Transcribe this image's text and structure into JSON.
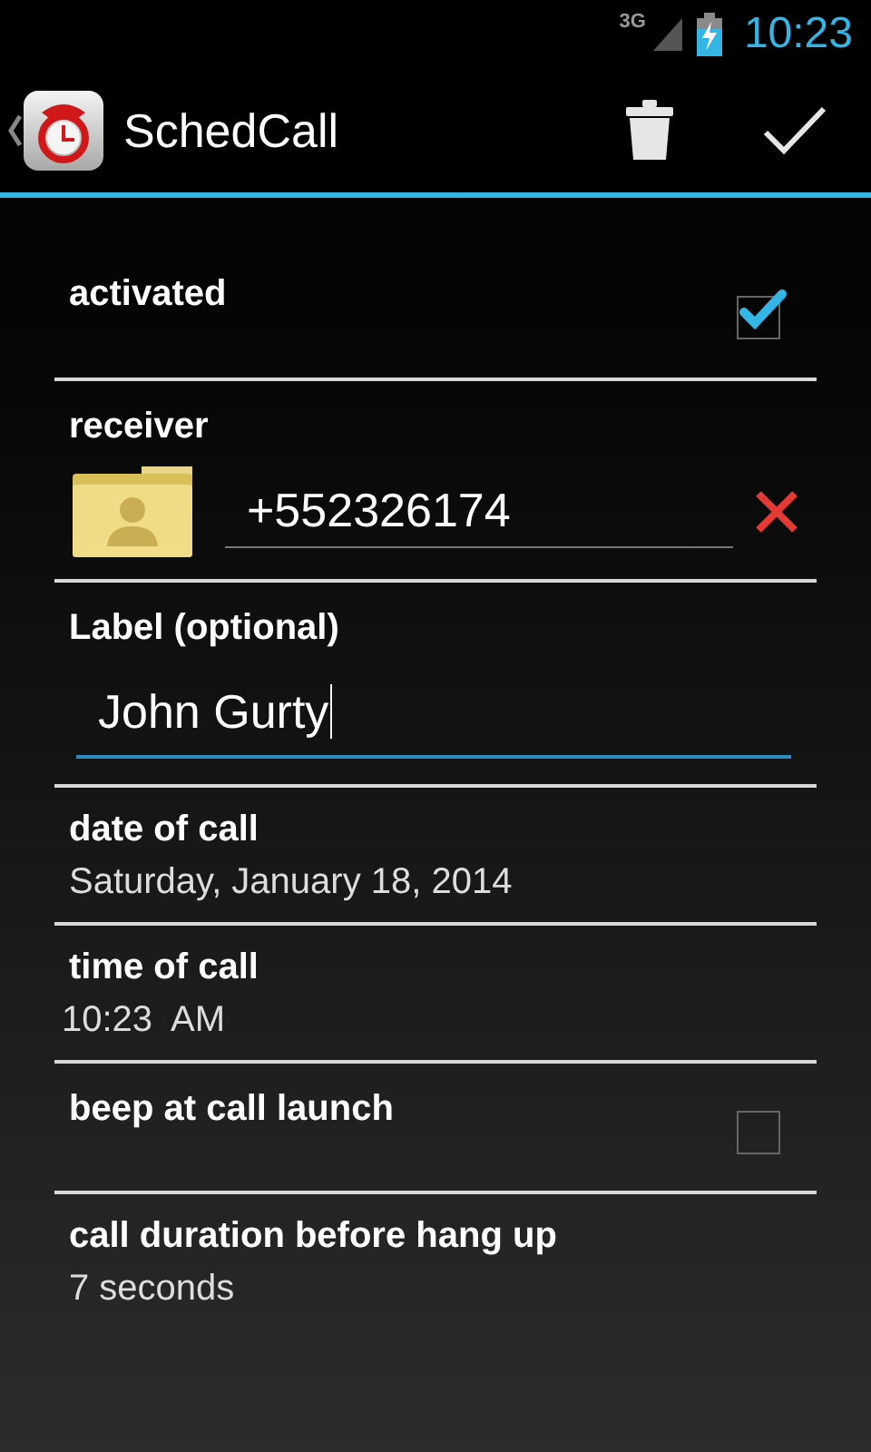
{
  "status_bar": {
    "network": "3G",
    "time": "10:23"
  },
  "action_bar": {
    "title": "SchedCall"
  },
  "settings": [
    {
      "kind": "checkbox",
      "label": "activated",
      "checked": true
    },
    {
      "kind": "receiver",
      "label": "receiver",
      "value": "+552326174"
    },
    {
      "kind": "text_field",
      "label": "Label (optional)",
      "value": "John Gurty",
      "focused": true
    },
    {
      "kind": "value",
      "label": "date of call",
      "value": "Saturday, January 18, 2014"
    },
    {
      "kind": "value",
      "label": "time of call",
      "value": "10:23  AM"
    },
    {
      "kind": "checkbox",
      "label": "beep at call launch",
      "checked": false
    },
    {
      "kind": "value",
      "label": "call duration before hang up",
      "value": "7 seconds"
    }
  ]
}
